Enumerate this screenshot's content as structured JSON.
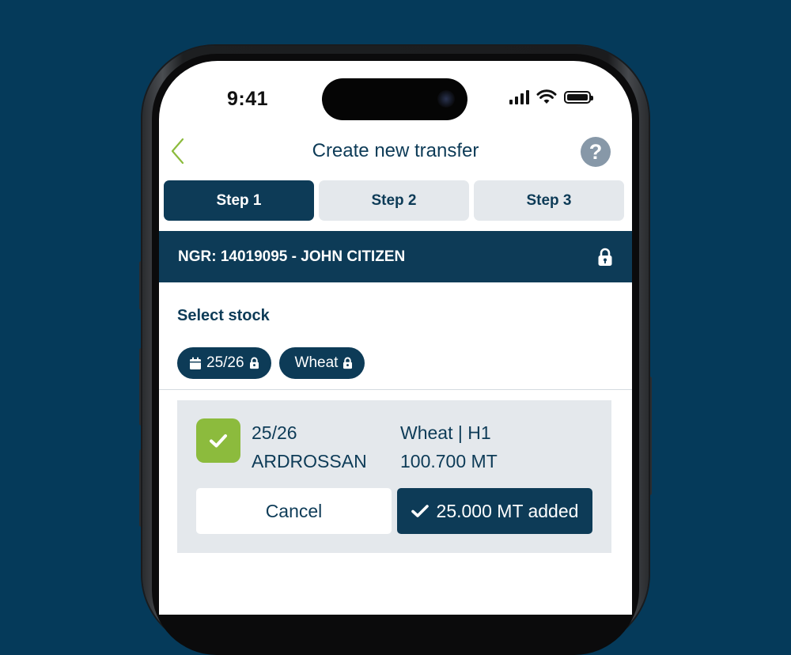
{
  "status_bar": {
    "time": "9:41"
  },
  "header": {
    "title": "Create new transfer",
    "back_icon": "chevron-left-icon",
    "help_label": "?"
  },
  "steps": [
    {
      "label": "Step 1",
      "active": true
    },
    {
      "label": "Step 2",
      "active": false
    },
    {
      "label": "Step 3",
      "active": false
    }
  ],
  "ngr": {
    "text": "NGR: 14019095 - JOHN CITIZEN",
    "icon": "lock-icon"
  },
  "select_stock": {
    "title": "Select stock",
    "chips": [
      {
        "label": "25/26",
        "leading_icon": "calendar-icon",
        "trailing_icon": "lock-icon"
      },
      {
        "label": "Wheat",
        "trailing_icon": "lock-icon"
      }
    ]
  },
  "stock_item": {
    "checked": true,
    "season": "25/26",
    "site": "ARDROSSAN",
    "grade": "Wheat | H1",
    "quantity": "100.700 MT",
    "cancel_label": "Cancel",
    "added_label": "25.000 MT added"
  },
  "colors": {
    "brand_navy": "#0d3b57",
    "background": "#053a5a",
    "accent_green": "#8cbb3d",
    "inactive_step": "#e4e8ec",
    "help_grey": "#8798a8"
  }
}
